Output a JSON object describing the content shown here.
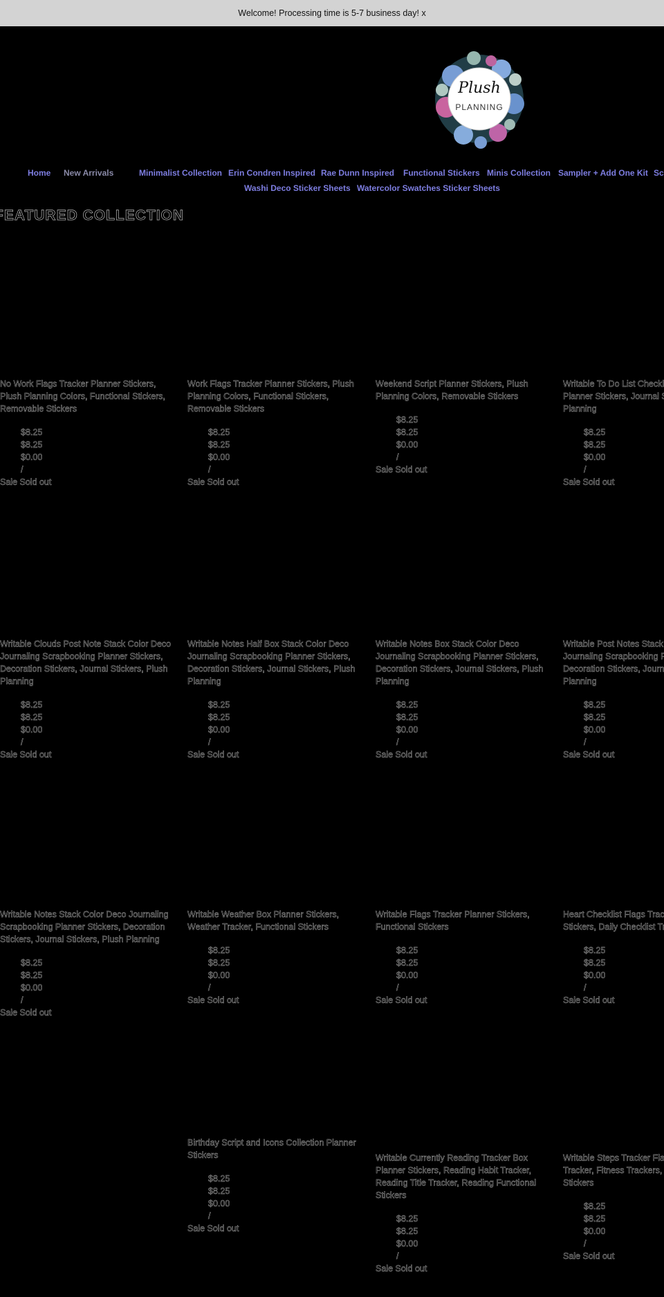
{
  "announcement": "Welcome! Processing time is 5-7 business day! x",
  "logo": {
    "script": "Plush",
    "text": "PLANNING"
  },
  "nav": {
    "items": [
      "Home",
      "New Arrivals",
      "Minimalist Collection",
      "Erin Condren Inspired",
      "Rae Dunn Inspired",
      "Functional Stickers",
      "Minis Collection",
      "Sampler + Add One Kit",
      "Sc",
      "Washi Deco Sticker Sheets",
      "Watercolor Swatches Sticker Sheets"
    ]
  },
  "featured_heading": "FEATURED COLLECTION",
  "price_labels": {
    "regular": "$8.25",
    "sale": "$8.25",
    "unit": "$0.00",
    "separator": "/",
    "status": "Sale Sold out"
  },
  "products": [
    {
      "title": "No Work Flags Tracker Planner Stickers, Plush Planning Colors, Functional Stickers, Removable Stickers"
    },
    {
      "title": "Work Flags Tracker Planner Stickers, Plush Planning Colors, Functional Stickers, Removable Stickers"
    },
    {
      "title": "Weekend Script Planner Stickers, Plush Planning Colors, Removable Stickers"
    },
    {
      "title": "Writable To Do List Checklist Scrapbooking Planner Stickers, Journal Stickers, Plush Planning"
    },
    {
      "title": "Writable Clouds Post Note Stack Color Deco Journaling Scrapbooking Planner Stickers, Decoration Stickers, Journal Stickers, Plush Planning"
    },
    {
      "title": "Writable Notes Half Box Stack Color Deco Journaling Scrapbooking Planner Stickers, Decoration Stickers, Journal Stickers, Plush Planning"
    },
    {
      "title": "Writable Notes Box Stack Color Deco Journaling Scrapbooking Planner Stickers, Decoration Stickers, Journal Stickers, Plush Planning"
    },
    {
      "title": "Writable Post Notes Stack Color Deco Journaling Scrapbooking Planner Stickers, Decoration Stickers, Journal Stickers, Plush Planning"
    },
    {
      "title": "Writable Notes Stack Color Deco Journaling Scrapbooking Planner Stickers, Decoration Stickers, Journal Stickers, Plush Planning"
    },
    {
      "title": "Writable Weather Box Planner Stickers, Weather Tracker, Functional Stickers"
    },
    {
      "title": "Writable Flags Tracker Planner Stickers, Functional Stickers"
    },
    {
      "title": "Heart Checklist Flags Tracker Planner Stickers, Daily Checklist Tracker"
    },
    {
      "title": "Birthday Script and Icons Collection Planner Stickers"
    },
    {
      "title": "Writable Currently Reading Tracker Box Planner Stickers, Reading Habit Tracker, Reading Title Tracker, Reading Functional Stickers"
    },
    {
      "title": "Writable Steps Tracker Flags Walk Steps Tracker, Fitness Trackers, Functional Stickers"
    }
  ]
}
